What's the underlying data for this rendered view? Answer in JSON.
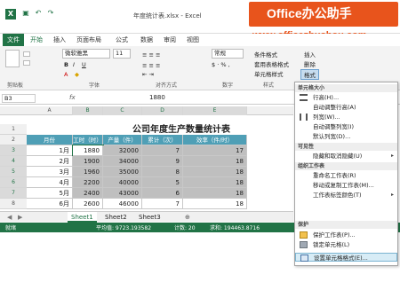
{
  "window": {
    "title": "年度统计表.xlsx - Excel"
  },
  "banner": {
    "title": "Office办公助手",
    "url": "www.officezhushou.com"
  },
  "ribbon_tabs": [
    "文件",
    "开始",
    "插入",
    "页面布局",
    "公式",
    "数据",
    "审阅",
    "视图"
  ],
  "ribbon": {
    "clipboard_label": "剪贴板",
    "font_name": "微软雅黑",
    "font_size": "11",
    "font_label": "字体",
    "align_label": "对齐方式",
    "number_format": "常规",
    "number_label": "数字",
    "styles": [
      "条件格式",
      "套用表格格式",
      "单元格样式"
    ],
    "styles_label": "样式",
    "cells": [
      "插入",
      "删除",
      "格式"
    ],
    "cells_label": "单元格"
  },
  "formula_bar": {
    "name_box": "B3",
    "fx": "fx",
    "value": "1880"
  },
  "columns": [
    "A",
    "B",
    "C",
    "D",
    "E"
  ],
  "rows": [
    "1",
    "2",
    "3",
    "4",
    "5",
    "6",
    "7",
    "8",
    "9"
  ],
  "table": {
    "title": "公司年度生产数量统计表",
    "headers": [
      "月份",
      "工时（时）",
      "产量（件）",
      "累计（次）",
      "效率（件/时）"
    ],
    "data": [
      [
        "1月",
        "1880",
        "32000",
        "7",
        "17"
      ],
      [
        "2月",
        "1900",
        "34000",
        "9",
        "18"
      ],
      [
        "3月",
        "1960",
        "35000",
        "8",
        "18"
      ],
      [
        "4月",
        "2200",
        "40000",
        "5",
        "18"
      ],
      [
        "5月",
        "2400",
        "43000",
        "6",
        "18"
      ],
      [
        "6月",
        "2600",
        "46000",
        "7",
        "18"
      ]
    ]
  },
  "sheet_tabs": [
    "Sheet1",
    "Sheet2",
    "Sheet3"
  ],
  "status": {
    "ready": "就绪",
    "average": "平均值: 9723.193582",
    "count": "计数: 20",
    "sum": "求和: 194463.8716"
  },
  "format_menu": {
    "sections": [
      {
        "head": "单元格大小",
        "items": [
          "行高(H)...",
          "自动调整行高(A)",
          "列宽(W)...",
          "自动调整列宽(I)",
          "默认列宽(D)..."
        ]
      },
      {
        "head": "可见性",
        "items": [
          "隐藏和取消隐藏(U)"
        ]
      },
      {
        "head": "组织工作表",
        "items": [
          "重命名工作表(R)",
          "移动或复制工作表(M)...",
          "工作表标签颜色(T)"
        ]
      },
      {
        "head": "保护",
        "items": [
          "保护工作表(P)...",
          "锁定单元格(L)",
          "设置单元格格式(E)..."
        ]
      }
    ]
  },
  "colors": {
    "excel_green": "#217346",
    "header_teal": "#4f9fb6",
    "banner_orange": "#e8541c"
  }
}
